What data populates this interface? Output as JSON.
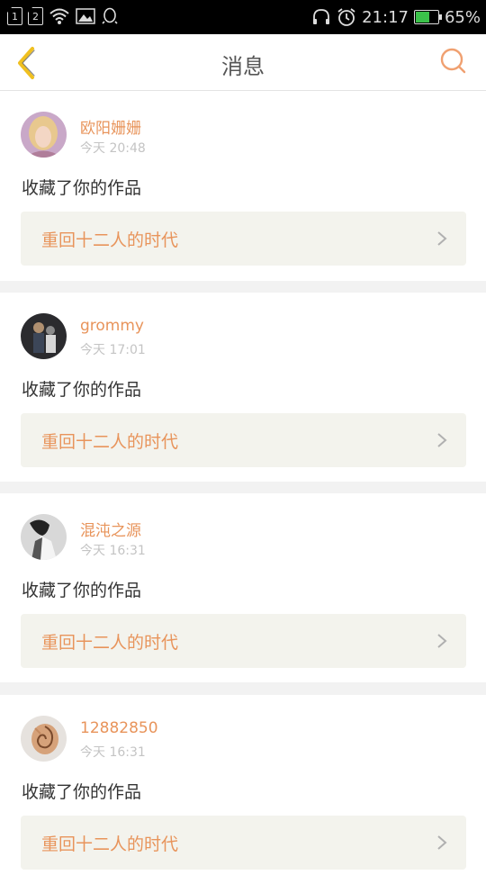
{
  "status_bar": {
    "sim1": "1",
    "sim2": "2",
    "time": "21:17",
    "battery": "65%",
    "battery_level": 0.65,
    "battery_color": "#3bc24a"
  },
  "header": {
    "title": "消息"
  },
  "colors": {
    "accent": "#e8945b",
    "back_arrow": "#f0c020"
  },
  "notifications": [
    {
      "user": "欧阳姗姗",
      "time": "今天 20:48",
      "action": "收藏了你的作品",
      "work": "重回十二人的时代"
    },
    {
      "user": "grommy",
      "time": "今天 17:01",
      "action": "收藏了你的作品",
      "work": "重回十二人的时代"
    },
    {
      "user": "混沌之源",
      "time": "今天 16:31",
      "action": "收藏了你的作品",
      "work": "重回十二人的时代"
    },
    {
      "user": "12882850",
      "time": "今天 16:31",
      "action": "收藏了你的作品",
      "work": "重回十二人的时代"
    }
  ]
}
